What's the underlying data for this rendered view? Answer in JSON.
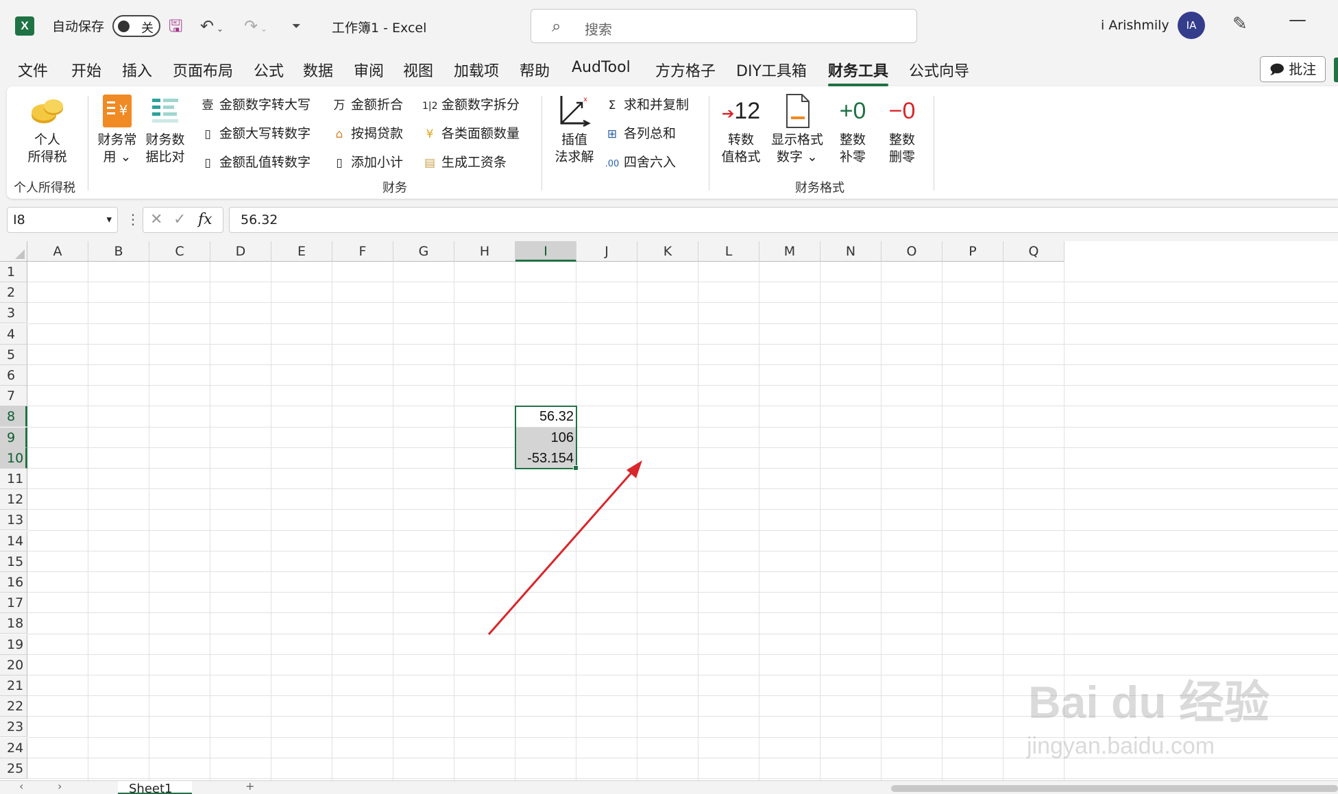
{
  "titlebar": {
    "autosave_label": "自动保存",
    "autosave_state": "关",
    "doc_title": "工作簿1  -  Excel",
    "search_placeholder": "搜索",
    "user_name": "i Arishmily",
    "avatar_initials": "IA"
  },
  "menu": {
    "tabs": [
      "文件",
      "开始",
      "插入",
      "页面布局",
      "公式",
      "数据",
      "审阅",
      "视图",
      "加载项",
      "帮助",
      "AudTool",
      "方方格子",
      "DIY工具箱",
      "财务工具",
      "公式向导"
    ],
    "active_tab": "财务工具",
    "comment_button": "批注"
  },
  "ribbon": {
    "personal_tax": {
      "label_line1": "个人",
      "label_line2": "所得税",
      "group": "个人所得税"
    },
    "finance_common": {
      "label_line1": "财务常",
      "label_line2": "用 ⌄"
    },
    "finance_compare": {
      "label_line1": "财务数",
      "label_line2": "据比对"
    },
    "col1": [
      "金额数字转大写",
      "金额大写转数字",
      "金额乱值转数字"
    ],
    "col2": [
      "金额折合",
      "按揭贷款",
      "添加小计"
    ],
    "col3": [
      "金额数字拆分",
      "各类面额数量",
      "生成工资条"
    ],
    "interp": {
      "label_line1": "插值",
      "label_line2": "法求解"
    },
    "col4": [
      "求和并复制",
      "各列总和",
      "四舍六入"
    ],
    "finance_group": "财务",
    "to_number_format": {
      "label_line1": "转数",
      "label_line2": "值格式",
      "icon_text": "12"
    },
    "show_format": {
      "label_line1": "显示格式",
      "label_line2": "数字 ⌄"
    },
    "round_pad": {
      "label_line1": "整数",
      "label_line2": "补零",
      "icon_text": "+0"
    },
    "round_del": {
      "label_line1": "整数",
      "label_line2": "删零",
      "icon_text": "−0"
    },
    "format_group": "财务格式",
    "colors": {
      "accent_green": "#1f7244",
      "red": "#d9262b"
    }
  },
  "formula_bar": {
    "name_box": "I8",
    "cancel_icon": "✕",
    "enter_icon": "✓",
    "fx_label": "fx",
    "formula": "56.32"
  },
  "grid": {
    "columns": [
      "A",
      "B",
      "C",
      "D",
      "E",
      "F",
      "G",
      "H",
      "I",
      "J",
      "K",
      "L",
      "M",
      "N",
      "O",
      "P",
      "Q"
    ],
    "rows": [
      "1",
      "2",
      "3",
      "4",
      "5",
      "6",
      "7",
      "8",
      "9",
      "10",
      "11",
      "12",
      "13",
      "14",
      "15",
      "16",
      "17",
      "18",
      "19",
      "20",
      "21",
      "22",
      "23",
      "24",
      "25"
    ],
    "selected_column": "I",
    "selected_range": "I8:I10",
    "cells": [
      {
        "ref": "I8",
        "value": "56.32"
      },
      {
        "ref": "I9",
        "value": "106"
      },
      {
        "ref": "I10",
        "value": "-53.154"
      }
    ]
  },
  "watermark": {
    "brand": "Bai du 经验",
    "url": "jingyan.baidu.com"
  },
  "sheets": {
    "tabs": [
      "Sheet1"
    ],
    "add_label": "+"
  }
}
